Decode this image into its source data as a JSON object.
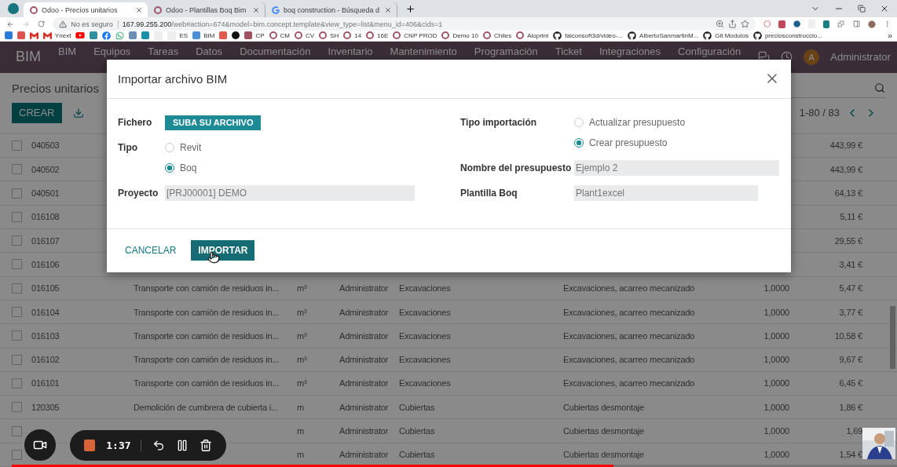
{
  "browser": {
    "tabs": [
      {
        "title": "Odoo - Precios unitarios",
        "kind": "odoo",
        "selected": true
      },
      {
        "title": "Odoo - Plantillas Boq Bim",
        "kind": "odoo",
        "selected": false
      },
      {
        "title": "boq construction - Búsqueda d",
        "kind": "google",
        "selected": false
      }
    ],
    "security": "No es seguro",
    "url_host": "167.99.255.200",
    "url_path": "/web#action=674&model=bim.concept.template&view_type=list&menu_id=406&cids=1",
    "bookmarks": [
      {
        "kind": "app",
        "color": "#2b7bd6"
      },
      {
        "kind": "app",
        "color": "#d9534f"
      },
      {
        "kind": "gmail"
      },
      {
        "kind": "gmail",
        "label": "Ynext"
      },
      {
        "kind": "youtube"
      },
      {
        "kind": "app",
        "color": "#2f8f9d"
      },
      {
        "kind": "facebook"
      },
      {
        "kind": "whatsapp"
      },
      {
        "kind": "app",
        "color": "#6e8fb4"
      },
      {
        "kind": "app",
        "color": "#1b8fa8"
      },
      {
        "kind": "wiki"
      },
      {
        "kind": "wiki",
        "label": "ES"
      },
      {
        "kind": "app",
        "color": "#4a90d9",
        "label": "BIM"
      },
      {
        "kind": "app",
        "color": "#e0584a"
      },
      {
        "kind": "dark"
      },
      {
        "kind": "app",
        "color": "#a0525f",
        "label": "CP"
      },
      {
        "kind": "odoo",
        "label": "CM"
      },
      {
        "kind": "odoo",
        "label": "CV"
      },
      {
        "kind": "odoo",
        "label": "SH"
      },
      {
        "kind": "odoo",
        "label": "14"
      },
      {
        "kind": "odoo",
        "label": "16E"
      },
      {
        "kind": "odoo",
        "label": "CNP PROD"
      },
      {
        "kind": "odoo",
        "label": "Demo 10"
      },
      {
        "kind": "odoo",
        "label": "Chiles"
      },
      {
        "kind": "odoo",
        "label": "Aloprint"
      },
      {
        "kind": "github",
        "label": "falconsoft3d/video-..."
      },
      {
        "kind": "github",
        "label": "AlbertoSanmartinM..."
      },
      {
        "kind": "github",
        "label": "Git Modulos"
      },
      {
        "kind": "github",
        "label": "preciosconstruccio..."
      }
    ],
    "bookmarks_more": "»"
  },
  "navbar": {
    "brand": "BIM",
    "menus": [
      "BIM",
      "Equipos",
      "Tareas",
      "Datos",
      "Documentación",
      "Inventario",
      "Mantenimiento",
      "Programación",
      "Ticket",
      "Integraciones",
      "Configuración"
    ],
    "avatar_letter": "A",
    "user": "Administrator"
  },
  "control_panel": {
    "title": "Precios unitarios",
    "create_button": "CREAR",
    "pager": "1-80 / 83"
  },
  "table": {
    "rows": [
      {
        "checked": false,
        "code": "040503",
        "price": "443,99 €"
      },
      {
        "checked": false,
        "code": "040502",
        "price": "443,99 €"
      },
      {
        "checked": false,
        "code": "040501",
        "price": "64,13 €"
      },
      {
        "checked": false,
        "code": "016108",
        "price": "5,11 €"
      },
      {
        "checked": false,
        "code": "016107",
        "price": "29,55 €"
      },
      {
        "checked": false,
        "code": "016106",
        "price": "3,41 €"
      },
      {
        "checked": false,
        "code": "016105",
        "description": "Transporte con camión de residuos in...",
        "unit": "m³",
        "user": "Administrator",
        "category": "Excavaciones",
        "group": "Excavaciones, acarreo mecanizado",
        "quantity": "1,0000",
        "price": "5,47 €"
      },
      {
        "checked": false,
        "code": "016104",
        "description": "Transporte con camión de residuos in...",
        "unit": "m³",
        "user": "Administrator",
        "category": "Excavaciones",
        "group": "Excavaciones, acarreo mecanizado",
        "quantity": "1,0000",
        "price": "3,77 €"
      },
      {
        "checked": false,
        "code": "016103",
        "description": "Transporte con camión de residuos in...",
        "unit": "m³",
        "user": "Administrator",
        "category": "Excavaciones",
        "group": "Excavaciones, acarreo mecanizado",
        "quantity": "1,0000",
        "price": "10,58 €"
      },
      {
        "checked": false,
        "code": "016102",
        "description": "Transporte con camión de residuos in...",
        "unit": "m³",
        "user": "Administrator",
        "category": "Excavaciones",
        "group": "Excavaciones, acarreo mecanizado",
        "quantity": "1,0000",
        "price": "9,67 €"
      },
      {
        "checked": false,
        "code": "016101",
        "description": "Transporte con camión de residuos in...",
        "unit": "m³",
        "user": "Administrator",
        "category": "Excavaciones",
        "group": "Excavaciones, acarreo mecanizado",
        "quantity": "1,0000",
        "price": "6,45 €"
      },
      {
        "checked": false,
        "code": "120305",
        "description": "Demolición de cumbrera de cubierta i...",
        "unit": "m",
        "user": "Administrator",
        "category": "Cubiertas",
        "group": "Cubiertas desmontaje",
        "quantity": "1,0000",
        "price": "1,86 €"
      },
      {
        "checked": false,
        "unit": "m",
        "user": "Administrator",
        "category": "Cubiertas",
        "group": "Cubiertas desmontaje",
        "quantity": "1,0000",
        "price": "1,69"
      },
      {
        "checked": false,
        "unit": "m",
        "user": "Administrator",
        "category": "Cubiertas",
        "group": "Cubiertas desmontaje",
        "quantity": "1,0000",
        "price": "1,54 €"
      }
    ]
  },
  "dialog": {
    "title": "Importar archivo BIM",
    "columns": [
      [
        {
          "label": "Fichero",
          "kind": "upload",
          "button": "SUBA SU ARCHIVO"
        },
        {
          "label": "Tipo",
          "kind": "radio",
          "options": [
            {
              "label": "Revit",
              "selected": false
            },
            {
              "label": "Boq",
              "selected": true
            }
          ]
        },
        {
          "label": "Proyecto",
          "kind": "text",
          "value": "[PRJ00001] DEMO"
        }
      ],
      [
        {
          "label": "Tipo importación",
          "kind": "radio",
          "options": [
            {
              "label": "Actualizar presupuesto",
              "selected": false
            },
            {
              "label": "Crear presupuesto",
              "selected": true
            }
          ]
        },
        {
          "label": "Nombre del presupuesto",
          "kind": "text",
          "value": "Ejemplo 2"
        },
        {
          "label": "Plantilla Boq",
          "kind": "text",
          "value": "Plant1excel"
        }
      ]
    ],
    "buttons": [
      {
        "label": "CANCELAR",
        "kind": "link"
      },
      {
        "label": "IMPORTAR",
        "kind": "primary"
      }
    ]
  },
  "recorder": {
    "time": "1:37"
  },
  "video_progress": {
    "level": 0.68
  }
}
